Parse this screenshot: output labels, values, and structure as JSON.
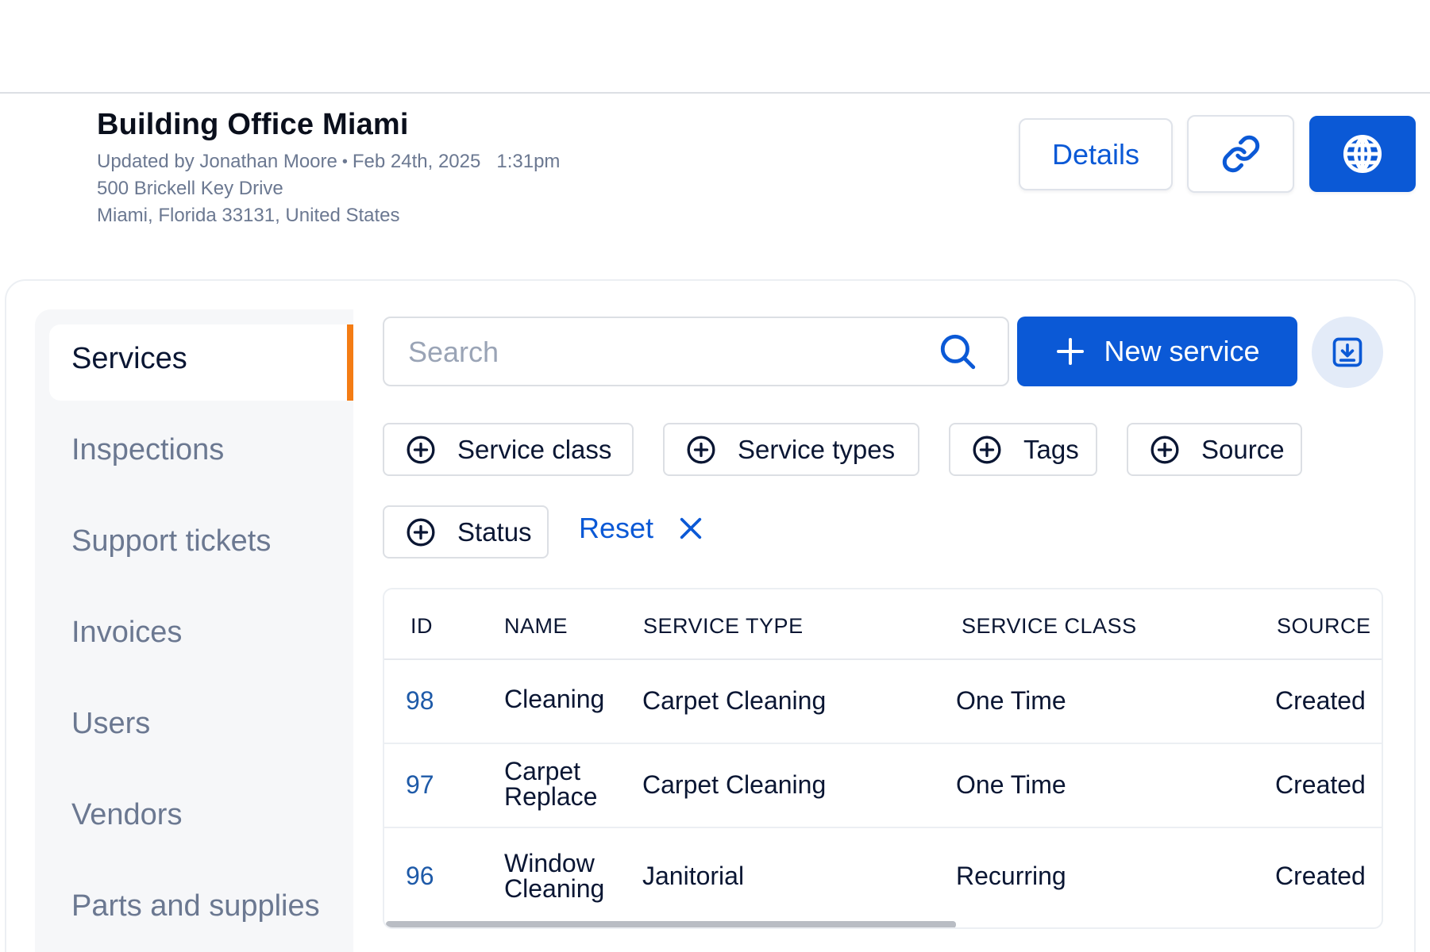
{
  "building": {
    "title": "Building Office Miami",
    "updated_by": "Updated by Jonathan Moore",
    "date": "Feb 24th, 2025",
    "time": "1:31pm",
    "address_line1": "500 Brickell Key Drive",
    "address_line2": "Miami, Florida 33131, United States"
  },
  "header_actions": {
    "details_label": "Details",
    "link_icon": "link-icon",
    "globe_icon": "globe-icon"
  },
  "sidebar": {
    "items": [
      {
        "label": "Services",
        "active": true
      },
      {
        "label": "Inspections",
        "active": false
      },
      {
        "label": "Support tickets",
        "active": false
      },
      {
        "label": "Invoices",
        "active": false
      },
      {
        "label": "Users",
        "active": false
      },
      {
        "label": "Vendors",
        "active": false
      },
      {
        "label": "Parts and supplies",
        "active": false
      }
    ]
  },
  "toolbar": {
    "search_placeholder": "Search",
    "search_value": "",
    "new_service_label": "New service",
    "download_icon": "download-icon"
  },
  "filters": {
    "chips": [
      "Service class",
      "Service types",
      "Tags",
      "Source",
      "Status"
    ],
    "reset_label": "Reset"
  },
  "table": {
    "columns": [
      "ID",
      "NAME",
      "SERVICE TYPE",
      "SERVICE CLASS",
      "SOURCE"
    ],
    "rows": [
      {
        "id": "98",
        "name": "Cleaning",
        "service_type": "Carpet Cleaning",
        "service_class": "One Time",
        "source": "Created"
      },
      {
        "id": "97",
        "name": "Carpet Replace",
        "service_type": "Carpet Cleaning",
        "service_class": "One Time",
        "source": "Created"
      },
      {
        "id": "96",
        "name": "Window Cleaning",
        "service_type": "Janitorial",
        "service_class": "Recurring",
        "source": "Created"
      }
    ]
  },
  "colors": {
    "primary": "#0b59d6",
    "accent": "#f47c14",
    "muted_text": "#6b7891",
    "sidebar_bg": "#f6f7f9"
  }
}
